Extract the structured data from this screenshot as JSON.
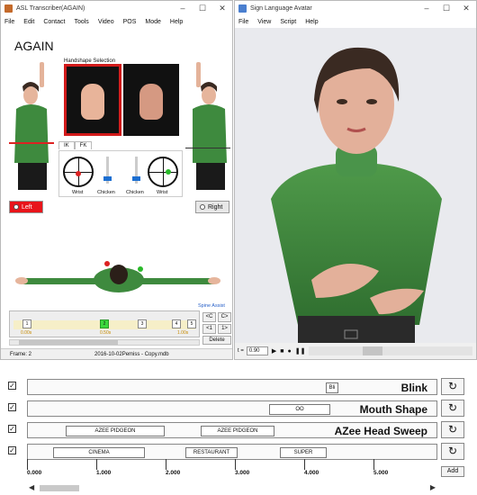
{
  "transcriber": {
    "title": "ASL Transcriber(AGAIN)",
    "menu": [
      "File",
      "Edit",
      "Contact",
      "Tools",
      "Video",
      "POS",
      "Mode",
      "Help"
    ],
    "word": "AGAIN",
    "handshape_label": "Handshape Selection",
    "tabs": [
      "IK",
      "FK"
    ],
    "dial_labels": [
      "Wrist",
      "Chicken",
      "Chicken",
      "Wrist"
    ],
    "left_button": "Left",
    "right_button": "Right",
    "spine_assist": "Spine Assist",
    "timeline": {
      "marks": [
        "1",
        "2",
        "3",
        "4",
        "5"
      ],
      "labels": [
        "0.00s",
        "0.50s",
        "1.00s"
      ]
    },
    "nav_buttons": [
      "<C",
      "C>",
      "<1",
      "1>"
    ],
    "delete_label": "Delete",
    "status": {
      "frame": "Frame:  2",
      "file": "2016-10-02Pemiss - Copy.mdb"
    },
    "colors": {
      "selected": "#e8141a",
      "accent": "#1c6fd1",
      "keyframe": "#3cd83c"
    }
  },
  "avatar_window": {
    "title": "Sign Language Avatar",
    "menu": [
      "File",
      "View",
      "Script",
      "Help"
    ],
    "time_label": "t =",
    "time_value": "0.90",
    "controls": [
      "play-icon",
      "stop-icon",
      "record-icon",
      "pause-icon"
    ]
  },
  "tracks": [
    {
      "title": "Blink",
      "checked": true,
      "blocks": [
        "Bli"
      ]
    },
    {
      "title": "Mouth Shape",
      "checked": true,
      "blocks": [
        "OO"
      ]
    },
    {
      "title": "AZee Head Sweep",
      "checked": true,
      "blocks": [
        "AZEE PIDGEON",
        "AZEE PIDGEON"
      ]
    },
    {
      "title": "",
      "checked": true,
      "blocks": [
        "CINEMA",
        "RESTAURANT",
        "SUPER"
      ]
    }
  ],
  "ruler": [
    "0.000",
    "1.000",
    "2.000",
    "3.000",
    "4.000",
    "5.000"
  ],
  "add_label": "Add"
}
